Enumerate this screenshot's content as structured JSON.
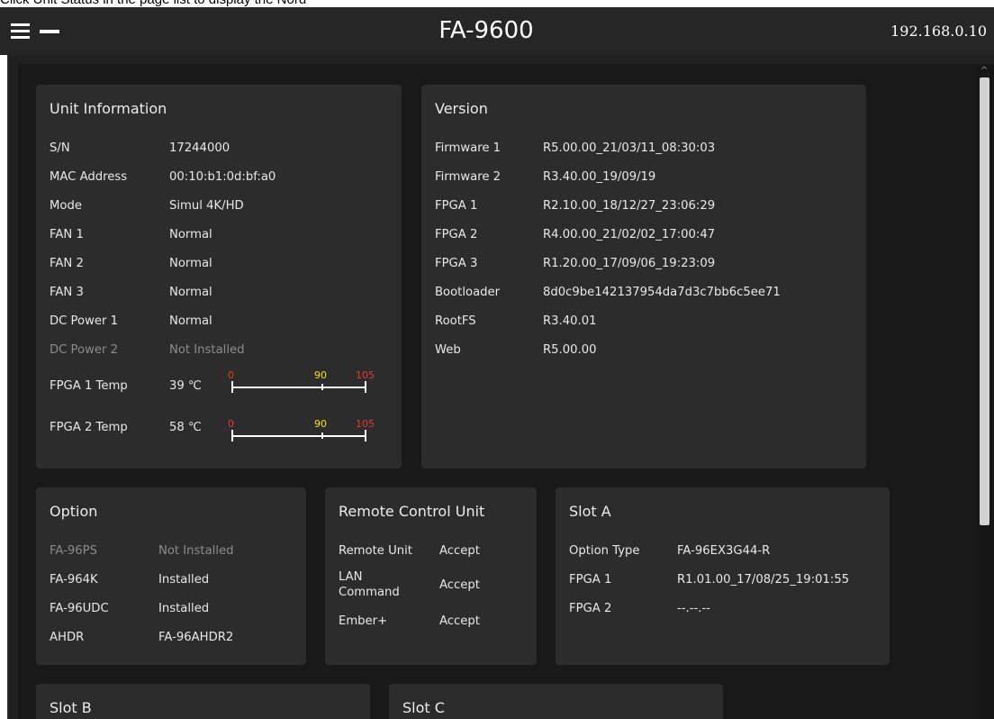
{
  "caption": "Click Unit Status in the page list to display the Nord",
  "header": {
    "title": "FA-9600",
    "ip_address": "192.168.0.10"
  },
  "unit_information": {
    "title": "Unit Information",
    "rows": [
      {
        "key": "S/N",
        "value": "17244000"
      },
      {
        "key": "MAC Address",
        "value": "00:10:b1:0d:bf:a0"
      },
      {
        "key": "Mode",
        "value": "Simul 4K/HD"
      },
      {
        "key": "FAN 1",
        "value": "Normal"
      },
      {
        "key": "FAN 2",
        "value": "Normal"
      },
      {
        "key": "FAN 3",
        "value": "Normal"
      },
      {
        "key": "DC Power 1",
        "value": "Normal"
      },
      {
        "key": "DC Power 2",
        "value": "Not Installed"
      }
    ],
    "temps": [
      {
        "key": "FPGA 1 Temp",
        "value": "39 ℃",
        "reading": 39,
        "scale_min": "0",
        "scale_warn": "90",
        "scale_max": "105"
      },
      {
        "key": "FPGA 2 Temp",
        "value": "58 ℃",
        "reading": 58,
        "scale_min": "0",
        "scale_warn": "90",
        "scale_max": "105"
      }
    ]
  },
  "version": {
    "title": "Version",
    "rows": [
      {
        "key": "Firmware 1",
        "value": "R5.00.00_21/03/11_08:30:03"
      },
      {
        "key": "Firmware 2",
        "value": "R3.40.00_19/09/19"
      },
      {
        "key": "FPGA 1",
        "value": "R2.10.00_18/12/27_23:06:29"
      },
      {
        "key": "FPGA 2",
        "value": "R4.00.00_21/02/02_17:00:47"
      },
      {
        "key": "FPGA 3",
        "value": "R1.20.00_17/09/06_19:23:09"
      },
      {
        "key": "Bootloader",
        "value": "8d0c9be142137954da7d3c7bb6c5ee71"
      },
      {
        "key": "RootFS",
        "value": "R3.40.01"
      },
      {
        "key": "Web",
        "value": "R5.00.00"
      }
    ]
  },
  "option": {
    "title": "Option",
    "rows": [
      {
        "key": "FA-96PS",
        "value": "Not Installed"
      },
      {
        "key": "FA-964K",
        "value": "Installed"
      },
      {
        "key": "FA-96UDC",
        "value": "Installed"
      },
      {
        "key": "AHDR",
        "value": "FA-96AHDR2"
      }
    ]
  },
  "remote_control_unit": {
    "title": "Remote Control Unit",
    "rows": [
      {
        "key": "Remote Unit",
        "value": "Accept"
      },
      {
        "key": "LAN",
        "key_line2": "Command",
        "value": "Accept"
      },
      {
        "key": "Ember+",
        "value": "Accept"
      }
    ]
  },
  "slot_a": {
    "title": "Slot A",
    "rows": [
      {
        "key": "Option Type",
        "value": "FA-96EX3G44-R"
      },
      {
        "key": "FPGA 1",
        "value": "R1.01.00_17/08/25_19:01:55"
      },
      {
        "key": "FPGA 2",
        "value": "--.--.--"
      }
    ]
  },
  "slot_b": {
    "title": "Slot B"
  },
  "slot_c": {
    "title": "Slot C"
  },
  "colors": {
    "topbar": "#262626",
    "background": "#191919",
    "panel": "#2c2c2c",
    "gauge_red": "#e53935",
    "gauge_yellow": "#f2e600"
  }
}
